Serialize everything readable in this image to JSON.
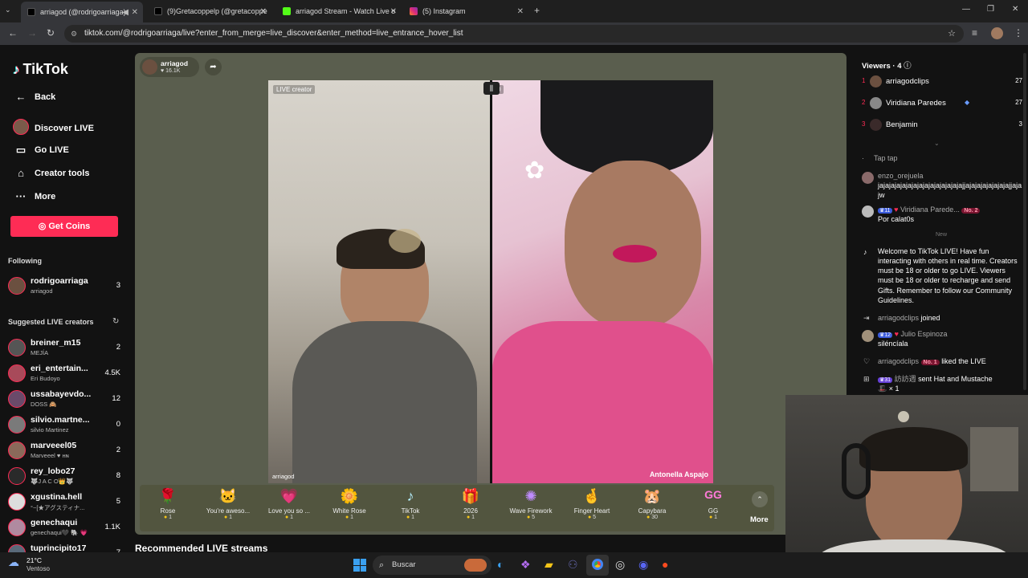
{
  "browser": {
    "tabs": [
      {
        "title": "arriagod (@rodrigoarriaga)",
        "icon": "tiktok-icon"
      },
      {
        "title": "(9)Gretacoppelp (@gretacoppe",
        "icon": "tiktok-icon"
      },
      {
        "title": "arriagod Stream - Watch Live o",
        "icon": "kick-icon"
      },
      {
        "title": "(5) Instagram",
        "icon": "instagram-icon"
      }
    ],
    "url": "tiktok.com/@rodrigoarriaga/live?enter_from_merge=live_discover&enter_method=live_entrance_hover_list"
  },
  "sidebar": {
    "logo": "TikTok",
    "back": "Back",
    "nav": [
      {
        "label": "Discover LIVE",
        "icon": "discover-avatar-icon"
      },
      {
        "label": "Go LIVE",
        "icon": "camera-icon"
      },
      {
        "label": "Creator tools",
        "icon": "house-icon"
      },
      {
        "label": "More",
        "icon": "ellipsis-icon"
      }
    ],
    "get_coins": "Get Coins",
    "following_title": "Following",
    "following": [
      {
        "name": "rodrigoarriaga",
        "sub": "arriagod",
        "count": "3"
      }
    ],
    "suggested_title": "Suggested LIVE creators",
    "suggested": [
      {
        "name": "breiner_m15",
        "sub": "MEJÍA",
        "count": "2"
      },
      {
        "name": "eri_entertain...",
        "sub": "Eri Budoyo",
        "count": "4.5K"
      },
      {
        "name": "ussabayevdo...",
        "sub": "DOSS 🙈",
        "count": "12"
      },
      {
        "name": "silvio.martne...",
        "sub": "silvio Martinez",
        "count": "0"
      },
      {
        "name": "marveeel05",
        "sub": "Marveeel ♥ ʜɴ",
        "count": "2"
      },
      {
        "name": "rey_lobo27",
        "sub": "🐺J A C O👑🐺",
        "count": "8"
      },
      {
        "name": "xgustina.hell",
        "sub": "°~[★アグスティナ...",
        "count": "5"
      },
      {
        "name": "genechaqui",
        "sub": "genechaqui🖤 🐘 💗",
        "count": "1.1K"
      },
      {
        "name": "tuprincipito17",
        "sub": "",
        "count": "7"
      }
    ]
  },
  "stream": {
    "host_name": "arriagod",
    "host_likes": "16.1K",
    "live_creator_tag": "LIVE creator",
    "score_right": "0",
    "left_name": "arriagod",
    "right_name": "Antonella Aspajo",
    "recommended": "Recommended LIVE streams"
  },
  "gifts": [
    {
      "name": "Rose",
      "price": "1",
      "icon": "🌹"
    },
    {
      "name": "You're aweso...",
      "price": "1",
      "icon": "🐱"
    },
    {
      "name": "Love you so ...",
      "price": "1",
      "icon": "💗"
    },
    {
      "name": "White Rose",
      "price": "1",
      "icon": "🌼"
    },
    {
      "name": "TikTok",
      "price": "1",
      "icon": "♪"
    },
    {
      "name": "2026",
      "price": "1",
      "icon": "🎁"
    },
    {
      "name": "Wave Firework",
      "price": "5",
      "icon": "✺"
    },
    {
      "name": "Finger Heart",
      "price": "5",
      "icon": "🤞"
    },
    {
      "name": "Capybara",
      "price": "30",
      "icon": "🐹"
    },
    {
      "name": "GG",
      "price": "1",
      "icon": "GG"
    }
  ],
  "gifts_more": "More",
  "viewers": {
    "title": "Viewers",
    "count": "4",
    "list": [
      {
        "rank": "1",
        "name": "arriagodclips",
        "score": "27"
      },
      {
        "rank": "2",
        "name": "Viridiana Paredes",
        "score": "27"
      },
      {
        "rank": "3",
        "name": "Benjamin",
        "score": "3"
      }
    ]
  },
  "chat": {
    "tap_tap": "Tap tap",
    "m1_user": "enzo_orejuela",
    "m1_text": "jajajajajajajajajajajajajajajajjajajajajajajajajjajajw",
    "m2_level": "11",
    "m2_user": "Viridiana Parede...",
    "m2_badge": "No. 2",
    "m2_text": "Por calat0s",
    "new_label": "New",
    "welcome": "Welcome to TikTok LIVE! Have fun interacting with others in real time. Creators must be 18 or older to go LIVE. Viewers must be 18 or older to recharge and send Gifts. Remember to follow our Community Guidelines.",
    "joined_user": "arriagodclips",
    "joined_text": "joined",
    "m3_level": "12",
    "m3_user": "Julio Espinoza",
    "m3_text": "siléncíala",
    "like_user": "arriagodclips",
    "like_badge": "No. 1",
    "like_text": "liked the LIVE",
    "gift_level": "31",
    "gift_user": "訪訪週",
    "gift_text": "sent Hat and Mustache",
    "gift_count": "× 1"
  },
  "taskbar": {
    "temp": "21°C",
    "weather": "Ventoso",
    "search": "Buscar"
  },
  "colors": {
    "accent": "#fe2c55",
    "stage": "#5a5e4e",
    "pink": "#e0508c"
  }
}
